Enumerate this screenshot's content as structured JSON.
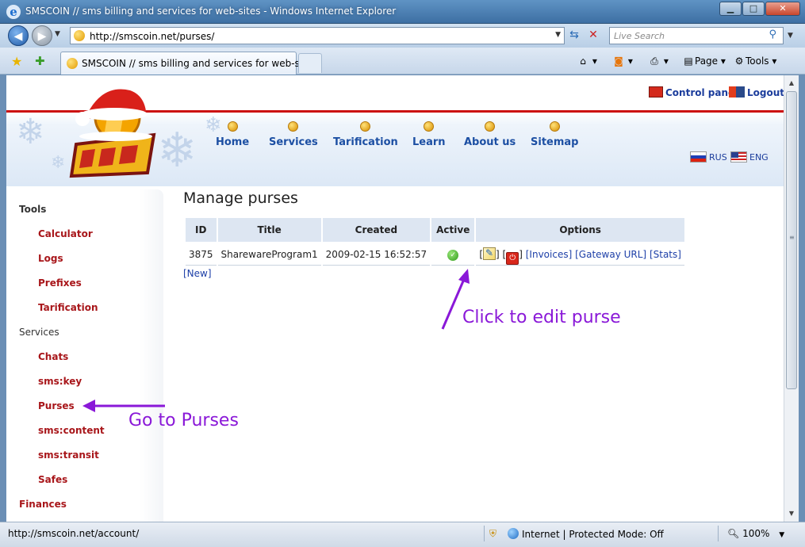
{
  "window": {
    "title": "SMSCOIN // sms billing and services for web-sites - Windows Internet Explorer",
    "minimize": "▁",
    "maximize": "□",
    "close": "✕"
  },
  "navbar": {
    "address": "http://smscoin.net/purses/",
    "search_placeholder": "Live Search"
  },
  "tabbar": {
    "tab_title": "SMSCOIN // sms billing and services for web-sites",
    "page_menu": "Page",
    "tools_menu": "Tools"
  },
  "header": {
    "control_panel": "Control panel",
    "logout": "Logout",
    "nav": [
      "Home",
      "Services",
      "Tarification",
      "Learn",
      "About us",
      "Sitemap"
    ],
    "lang_ru": "RUS",
    "lang_en": "ENG"
  },
  "sidebar": {
    "sections": [
      {
        "title": "Tools",
        "items": [
          "Calculator",
          "Logs",
          "Prefixes",
          "Tarification"
        ]
      },
      {
        "title": "Services",
        "items": [
          "Chats",
          "sms:key",
          "Purses",
          "sms:content",
          "sms:transit",
          "Safes"
        ]
      },
      {
        "title": "Finances",
        "items": []
      }
    ]
  },
  "main": {
    "title": "Manage purses",
    "table": {
      "headers": [
        "ID",
        "Title",
        "Created",
        "Active",
        "Options"
      ],
      "rows": [
        {
          "id": "3875",
          "title": "SharewareProgram1",
          "created": "2009-02-15 16:52:57",
          "active": true,
          "options": {
            "bracket_open": "[",
            "bracket_close": "]",
            "invoices": "[Invoices]",
            "gateway": "[Gateway URL]",
            "stats": "[Stats]"
          }
        }
      ]
    },
    "new_link": "[New]"
  },
  "annotations": {
    "edit": "Click to edit purse",
    "purses": "Go to Purses",
    "color": "#8a18d8"
  },
  "statusbar": {
    "text": "http://smscoin.net/account/",
    "zone": "Internet | Protected Mode: Off",
    "zoom": "100%"
  },
  "colors": {
    "accent_red": "#cc1010",
    "nav_blue": "#1c4fa3",
    "sidebar_link": "#a8161a"
  }
}
